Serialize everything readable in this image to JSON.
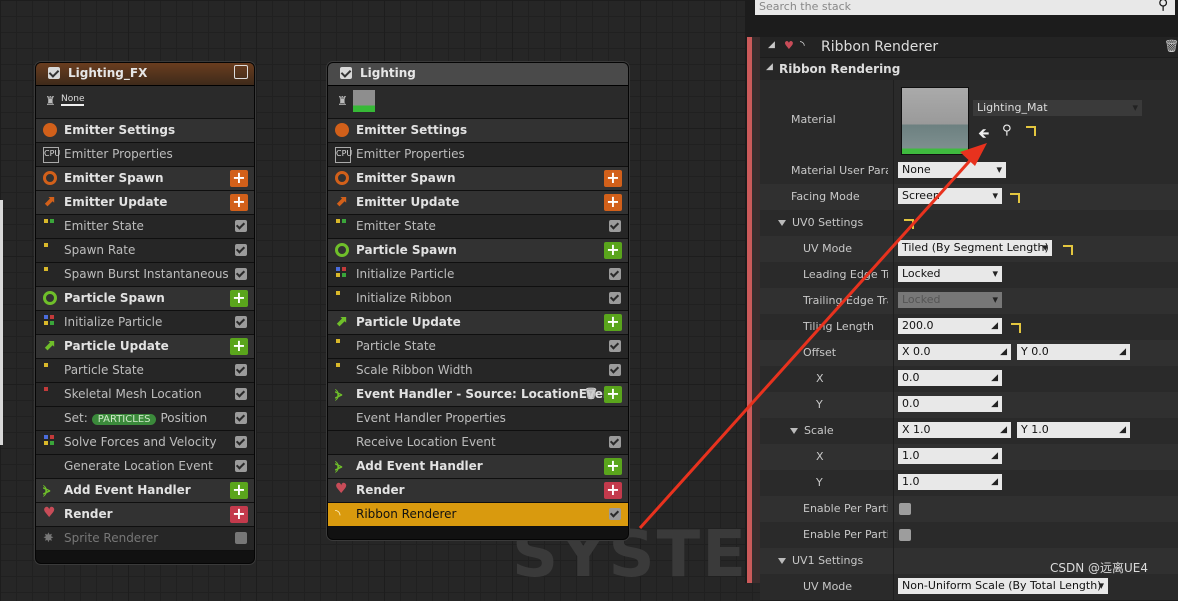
{
  "watermark": "SYSTEM",
  "csdn": "CSDN @远离UE4",
  "emitter1": {
    "title": "Lighting_FX",
    "thumb_label": "None",
    "rows": [
      {
        "label": "Emitter Settings",
        "kind": "sec"
      },
      {
        "label": "Emitter Properties",
        "kind": "mod"
      },
      {
        "label": "Emitter Spawn",
        "kind": "sec"
      },
      {
        "label": "Emitter Update",
        "kind": "sec"
      },
      {
        "label": "Emitter State",
        "kind": "mod"
      },
      {
        "label": "Spawn Rate",
        "kind": "mod"
      },
      {
        "label": "Spawn Burst Instantaneous",
        "kind": "mod"
      },
      {
        "label": "Particle Spawn",
        "kind": "sec"
      },
      {
        "label": "Initialize Particle",
        "kind": "mod"
      },
      {
        "label": "Particle Update",
        "kind": "sec"
      },
      {
        "label": "Particle State",
        "kind": "mod"
      },
      {
        "label": "Skeletal Mesh Location",
        "kind": "mod"
      },
      {
        "label": "Set:",
        "pill": "PARTICLES",
        "suffix": "Position",
        "kind": "mod"
      },
      {
        "label": "Solve Forces and Velocity",
        "kind": "mod"
      },
      {
        "label": "Generate Location Event",
        "kind": "mod"
      },
      {
        "label": "Add Event Handler",
        "kind": "sec"
      },
      {
        "label": "Render",
        "kind": "sec"
      },
      {
        "label": "Sprite Renderer",
        "kind": "mod"
      }
    ]
  },
  "emitter2": {
    "title": "Lighting",
    "rows": [
      {
        "label": "Emitter Settings"
      },
      {
        "label": "Emitter Properties"
      },
      {
        "label": "Emitter Spawn"
      },
      {
        "label": "Emitter Update"
      },
      {
        "label": "Emitter State"
      },
      {
        "label": "Particle Spawn"
      },
      {
        "label": "Initialize Particle"
      },
      {
        "label": "Initialize Ribbon"
      },
      {
        "label": "Particle Update"
      },
      {
        "label": "Particle State"
      },
      {
        "label": "Scale Ribbon Width"
      },
      {
        "label": "Event Handler - Source: LocationEvent"
      },
      {
        "label": "Event Handler Properties"
      },
      {
        "label": "Receive Location Event"
      },
      {
        "label": "Add Event Handler"
      },
      {
        "label": "Render"
      },
      {
        "label": "Ribbon Renderer"
      }
    ]
  },
  "details": {
    "search_placeholder": "Search the stack",
    "header": "Ribbon Renderer",
    "section": "Ribbon Rendering",
    "material_label": "Material",
    "material_value": "Lighting_Mat",
    "props": {
      "material_user_param": {
        "label": "Material User Parar",
        "value": "None"
      },
      "facing_mode": {
        "label": "Facing Mode",
        "value": "Screen"
      },
      "uv0": {
        "label": "UV0 Settings"
      },
      "uv_mode": {
        "label": "UV Mode",
        "value": "Tiled (By Segment Length)"
      },
      "leading_edge": {
        "label": "Leading Edge Tra",
        "value": "Locked"
      },
      "trailing_edge": {
        "label": "Trailing Edge Tra",
        "value": "Locked"
      },
      "tiling_length": {
        "label": "Tiling Length",
        "value": "200.0"
      },
      "offset": {
        "label": "Offset",
        "x": "X  0.0",
        "y": "Y  0.0"
      },
      "offset_x": {
        "label": "X",
        "value": "0.0"
      },
      "offset_y": {
        "label": "Y",
        "value": "0.0"
      },
      "scale": {
        "label": "Scale",
        "x": "X  1.0",
        "y": "Y  1.0"
      },
      "scale_x": {
        "label": "X",
        "value": "1.0"
      },
      "scale_y": {
        "label": "Y",
        "value": "1.0"
      },
      "enable1": {
        "label": "Enable Per Partic"
      },
      "enable2": {
        "label": "Enable Per Partic"
      },
      "uv1": {
        "label": "UV1 Settings"
      },
      "uv1_mode": {
        "label": "UV Mode",
        "value": "Non-Uniform Scale (By Total Length)"
      }
    }
  },
  "colors": {
    "accent_orange": "#d99a0e",
    "annotation_red": "#e8321e"
  }
}
